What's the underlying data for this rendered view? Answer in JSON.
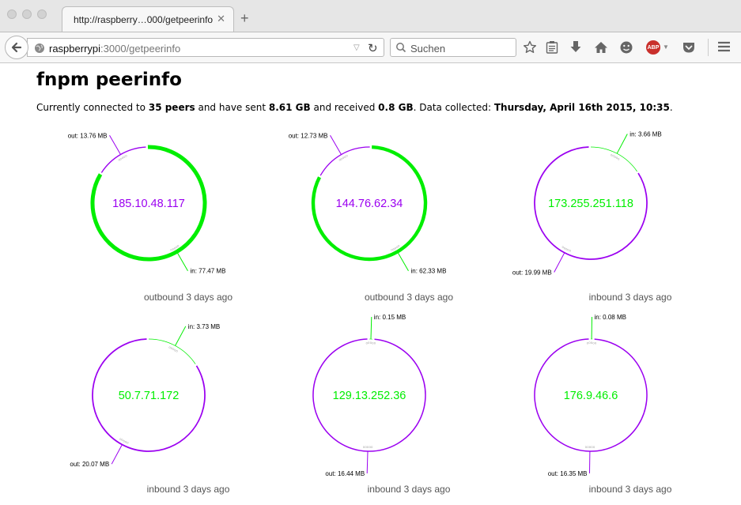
{
  "browser": {
    "tab_title": "http://raspberry…000/getpeerinfo",
    "tab_close": "✕",
    "new_tab": "+",
    "url_host": "raspberrypi",
    "url_path": ":3000/getpeerinfo",
    "search_placeholder": "Suchen",
    "abp_label": "ABP"
  },
  "page": {
    "heading": "fnpm peerinfo",
    "summary": {
      "p1": "Currently connected to ",
      "peers": "35 peers",
      "p2": " and have sent ",
      "sent": "8.61 GB",
      "p3": " and received ",
      "received": "0.8 GB",
      "p4": ". Data collected: ",
      "collected": "Thursday, April 16th 2015, 10:35",
      "p5": "."
    }
  },
  "colors": {
    "in": "#00ee00",
    "out": "#9b00f0"
  },
  "peers": [
    {
      "ip": "185.10.48.117",
      "out_label": "out: 13.76 MB",
      "in_label": "in: 77.47 MB",
      "out_mb": 13.76,
      "in_mb": 77.47,
      "caption": "outbound 3 days ago"
    },
    {
      "ip": "144.76.62.34",
      "out_label": "out: 12.73 MB",
      "in_label": "in: 62.33 MB",
      "out_mb": 12.73,
      "in_mb": 62.33,
      "caption": "outbound 3 days ago"
    },
    {
      "ip": "173.255.251.118",
      "out_label": "out: 19.99 MB",
      "in_label": "in: 3.66 MB",
      "out_mb": 19.99,
      "in_mb": 3.66,
      "caption": "inbound 3 days ago"
    },
    {
      "ip": "50.7.71.172",
      "out_label": "out: 20.07 MB",
      "in_label": "in: 3.73 MB",
      "out_mb": 20.07,
      "in_mb": 3.73,
      "caption": "inbound 3 days ago"
    },
    {
      "ip": "129.13.252.36",
      "out_label": "out: 16.44 MB",
      "in_label": "in: 0.15 MB",
      "out_mb": 16.44,
      "in_mb": 0.15,
      "caption": "inbound 3 days ago"
    },
    {
      "ip": "176.9.46.6",
      "out_label": "out: 16.35 MB",
      "in_label": "in: 0.08 MB",
      "out_mb": 16.35,
      "in_mb": 0.08,
      "caption": "inbound 3 days ago"
    }
  ]
}
